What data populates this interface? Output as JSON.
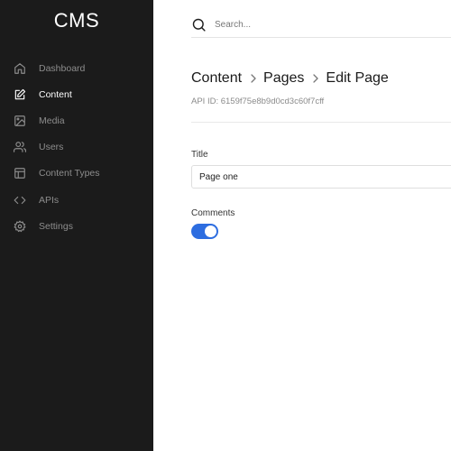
{
  "sidebar": {
    "brand": "CMS",
    "items": [
      {
        "label": "Dashboard",
        "icon": "home-icon",
        "active": false
      },
      {
        "label": "Content",
        "icon": "edit-icon",
        "active": true
      },
      {
        "label": "Media",
        "icon": "image-icon",
        "active": false
      },
      {
        "label": "Users",
        "icon": "users-icon",
        "active": false
      },
      {
        "label": "Content Types",
        "icon": "layout-icon",
        "active": false
      },
      {
        "label": "APIs",
        "icon": "code-icon",
        "active": false
      },
      {
        "label": "Settings",
        "icon": "gear-icon",
        "active": false
      }
    ]
  },
  "search": {
    "placeholder": "Search..."
  },
  "breadcrumb": [
    "Content",
    "Pages",
    "Edit Page"
  ],
  "api_id": "API ID: 6159f75e8b9d0cd3c60f7cff",
  "form": {
    "title_label": "Title",
    "title_value": "Page one",
    "comments_label": "Comments",
    "comments_enabled": true
  },
  "colors": {
    "sidebar_bg": "#1b1b1b",
    "accent": "#2d6de0",
    "inactive_text": "#8d8d8d"
  }
}
